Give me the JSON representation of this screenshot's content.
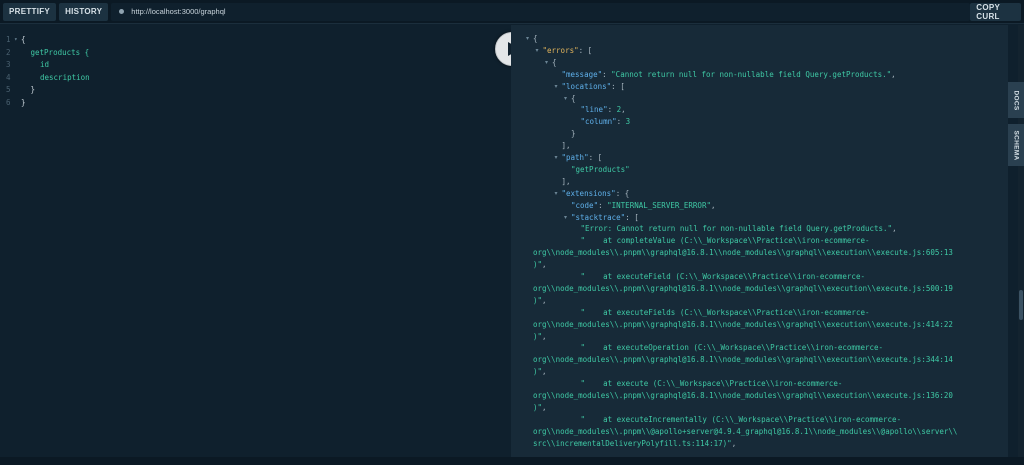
{
  "toolbar": {
    "prettify_label": "PRETTIFY",
    "history_label": "HISTORY",
    "url": "http://localhost:3000/graphql",
    "copy_curl_label": "COPY CURL"
  },
  "editor": {
    "lines": [
      {
        "num": "1",
        "fold": true,
        "indent": 0,
        "text": "{",
        "type": "punc"
      },
      {
        "num": "2",
        "fold": false,
        "indent": 1,
        "text": "getProducts {",
        "type": "field"
      },
      {
        "num": "3",
        "fold": false,
        "indent": 2,
        "text": "id",
        "type": "field"
      },
      {
        "num": "4",
        "fold": false,
        "indent": 2,
        "text": "description",
        "type": "field"
      },
      {
        "num": "5",
        "fold": false,
        "indent": 1,
        "text": "}",
        "type": "punc"
      },
      {
        "num": "6",
        "fold": false,
        "indent": 0,
        "text": "}",
        "type": "punc"
      }
    ]
  },
  "side_tabs": {
    "docs_label": "DOCS",
    "schema_label": "SCHEMA"
  },
  "result": {
    "lines": [
      {
        "fold": true,
        "indent": 0,
        "parts": [
          {
            "t": "{",
            "c": "punc"
          }
        ]
      },
      {
        "fold": true,
        "indent": 1,
        "parts": [
          {
            "t": "\"errors\"",
            "c": "key"
          },
          {
            "t": ": [",
            "c": "punc"
          }
        ]
      },
      {
        "fold": true,
        "indent": 2,
        "parts": [
          {
            "t": "{",
            "c": "punc"
          }
        ]
      },
      {
        "fold": false,
        "indent": 3,
        "parts": [
          {
            "t": "\"message\"",
            "c": "key2"
          },
          {
            "t": ": ",
            "c": "punc"
          },
          {
            "t": "\"Cannot return null for non-nullable field Query.getProducts.\"",
            "c": "str"
          },
          {
            "t": ",",
            "c": "punc"
          }
        ]
      },
      {
        "fold": true,
        "indent": 3,
        "parts": [
          {
            "t": "\"locations\"",
            "c": "key2"
          },
          {
            "t": ": [",
            "c": "punc"
          }
        ]
      },
      {
        "fold": true,
        "indent": 4,
        "parts": [
          {
            "t": "{",
            "c": "punc"
          }
        ]
      },
      {
        "fold": false,
        "indent": 5,
        "parts": [
          {
            "t": "\"line\"",
            "c": "key2"
          },
          {
            "t": ": ",
            "c": "punc"
          },
          {
            "t": "2",
            "c": "num"
          },
          {
            "t": ",",
            "c": "punc"
          }
        ]
      },
      {
        "fold": false,
        "indent": 5,
        "parts": [
          {
            "t": "\"column\"",
            "c": "key2"
          },
          {
            "t": ": ",
            "c": "punc"
          },
          {
            "t": "3",
            "c": "num"
          }
        ]
      },
      {
        "fold": false,
        "indent": 4,
        "parts": [
          {
            "t": "}",
            "c": "punc"
          }
        ]
      },
      {
        "fold": false,
        "indent": 3,
        "parts": [
          {
            "t": "],",
            "c": "punc"
          }
        ]
      },
      {
        "fold": true,
        "indent": 3,
        "parts": [
          {
            "t": "\"path\"",
            "c": "key2"
          },
          {
            "t": ": [",
            "c": "punc"
          }
        ]
      },
      {
        "fold": false,
        "indent": 4,
        "parts": [
          {
            "t": "\"getProducts\"",
            "c": "str"
          }
        ]
      },
      {
        "fold": false,
        "indent": 3,
        "parts": [
          {
            "t": "],",
            "c": "punc"
          }
        ]
      },
      {
        "fold": true,
        "indent": 3,
        "parts": [
          {
            "t": "\"extensions\"",
            "c": "key2"
          },
          {
            "t": ": {",
            "c": "punc"
          }
        ]
      },
      {
        "fold": false,
        "indent": 4,
        "parts": [
          {
            "t": "\"code\"",
            "c": "key2"
          },
          {
            "t": ": ",
            "c": "punc"
          },
          {
            "t": "\"INTERNAL_SERVER_ERROR\"",
            "c": "str"
          },
          {
            "t": ",",
            "c": "punc"
          }
        ]
      },
      {
        "fold": true,
        "indent": 4,
        "parts": [
          {
            "t": "\"stacktrace\"",
            "c": "key2"
          },
          {
            "t": ": [",
            "c": "punc"
          }
        ]
      },
      {
        "fold": false,
        "indent": 5,
        "parts": [
          {
            "t": "\"Error: Cannot return null for non-nullable field Query.getProducts.\"",
            "c": "str"
          },
          {
            "t": ",",
            "c": "punc"
          }
        ]
      },
      {
        "fold": false,
        "indent": 5,
        "parts": [
          {
            "t": "\"    at completeValue (C:\\\\_Workspace\\\\Practice\\\\iron-ecommerce-",
            "c": "str"
          }
        ]
      },
      {
        "fold": false,
        "indent": 0,
        "parts": [
          {
            "t": "org\\\\node_modules\\\\.pnpm\\\\graphql@16.8.1\\\\node_modules\\\\graphql\\\\execution\\\\execute.js:605:13",
            "c": "str"
          }
        ]
      },
      {
        "fold": false,
        "indent": 0,
        "parts": [
          {
            "t": ")\"",
            "c": "str"
          },
          {
            "t": ",",
            "c": "punc"
          }
        ]
      },
      {
        "fold": false,
        "indent": 5,
        "parts": [
          {
            "t": "\"    at executeField (C:\\\\_Workspace\\\\Practice\\\\iron-ecommerce-",
            "c": "str"
          }
        ]
      },
      {
        "fold": false,
        "indent": 0,
        "parts": [
          {
            "t": "org\\\\node_modules\\\\.pnpm\\\\graphql@16.8.1\\\\node_modules\\\\graphql\\\\execution\\\\execute.js:500:19",
            "c": "str"
          }
        ]
      },
      {
        "fold": false,
        "indent": 0,
        "parts": [
          {
            "t": ")\"",
            "c": "str"
          },
          {
            "t": ",",
            "c": "punc"
          }
        ]
      },
      {
        "fold": false,
        "indent": 5,
        "parts": [
          {
            "t": "\"    at executeFields (C:\\\\_Workspace\\\\Practice\\\\iron-ecommerce-",
            "c": "str"
          }
        ]
      },
      {
        "fold": false,
        "indent": 0,
        "parts": [
          {
            "t": "org\\\\node_modules\\\\.pnpm\\\\graphql@16.8.1\\\\node_modules\\\\graphql\\\\execution\\\\execute.js:414:22",
            "c": "str"
          }
        ]
      },
      {
        "fold": false,
        "indent": 0,
        "parts": [
          {
            "t": ")\"",
            "c": "str"
          },
          {
            "t": ",",
            "c": "punc"
          }
        ]
      },
      {
        "fold": false,
        "indent": 5,
        "parts": [
          {
            "t": "\"    at executeOperation (C:\\\\_Workspace\\\\Practice\\\\iron-ecommerce-",
            "c": "str"
          }
        ]
      },
      {
        "fold": false,
        "indent": 0,
        "parts": [
          {
            "t": "org\\\\node_modules\\\\.pnpm\\\\graphql@16.8.1\\\\node_modules\\\\graphql\\\\execution\\\\execute.js:344:14",
            "c": "str"
          }
        ]
      },
      {
        "fold": false,
        "indent": 0,
        "parts": [
          {
            "t": ")\"",
            "c": "str"
          },
          {
            "t": ",",
            "c": "punc"
          }
        ]
      },
      {
        "fold": false,
        "indent": 5,
        "parts": [
          {
            "t": "\"    at execute (C:\\\\_Workspace\\\\Practice\\\\iron-ecommerce-",
            "c": "str"
          }
        ]
      },
      {
        "fold": false,
        "indent": 0,
        "parts": [
          {
            "t": "org\\\\node_modules\\\\.pnpm\\\\graphql@16.8.1\\\\node_modules\\\\graphql\\\\execution\\\\execute.js:136:20",
            "c": "str"
          }
        ]
      },
      {
        "fold": false,
        "indent": 0,
        "parts": [
          {
            "t": ")\"",
            "c": "str"
          },
          {
            "t": ",",
            "c": "punc"
          }
        ]
      },
      {
        "fold": false,
        "indent": 5,
        "parts": [
          {
            "t": "\"    at executeIncrementally (C:\\\\_Workspace\\\\Practice\\\\iron-ecommerce-",
            "c": "str"
          }
        ]
      },
      {
        "fold": false,
        "indent": 0,
        "parts": [
          {
            "t": "org\\\\node_modules\\\\.pnpm\\\\@apollo+server@4.9.4_graphql@16.8.1\\\\node_modules\\\\@apollo\\\\server\\\\",
            "c": "str"
          }
        ]
      },
      {
        "fold": false,
        "indent": 0,
        "parts": [
          {
            "t": "src\\\\incrementalDeliveryPolyfill.ts:114:17)\"",
            "c": "str"
          },
          {
            "t": ",",
            "c": "punc"
          }
        ]
      }
    ]
  }
}
